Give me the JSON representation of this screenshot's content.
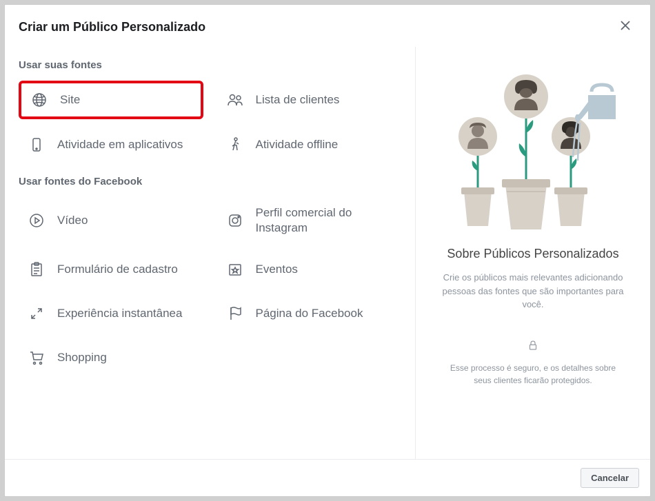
{
  "modal": {
    "title": "Criar um Público Personalizado",
    "cancel_label": "Cancelar"
  },
  "sections": {
    "your_sources": {
      "heading": "Usar suas fontes",
      "items": {
        "site": "Site",
        "customer_list": "Lista de clientes",
        "app_activity": "Atividade em aplicativos",
        "offline_activity": "Atividade offline"
      }
    },
    "facebook_sources": {
      "heading": "Usar fontes do Facebook",
      "items": {
        "video": "Vídeo",
        "instagram_profile": "Perfil comercial do Instagram",
        "lead_form": "Formulário de cadastro",
        "events": "Eventos",
        "instant_experience": "Experiência instantânea",
        "facebook_page": "Página do Facebook",
        "shopping": "Shopping"
      }
    }
  },
  "info": {
    "title": "Sobre Públicos Personalizados",
    "description": "Crie os públicos mais relevantes adicionando pessoas das fontes que são importantes para você.",
    "security_text": "Esse processo é seguro, e os detalhes sobre seus clientes ficarão protegidos."
  }
}
